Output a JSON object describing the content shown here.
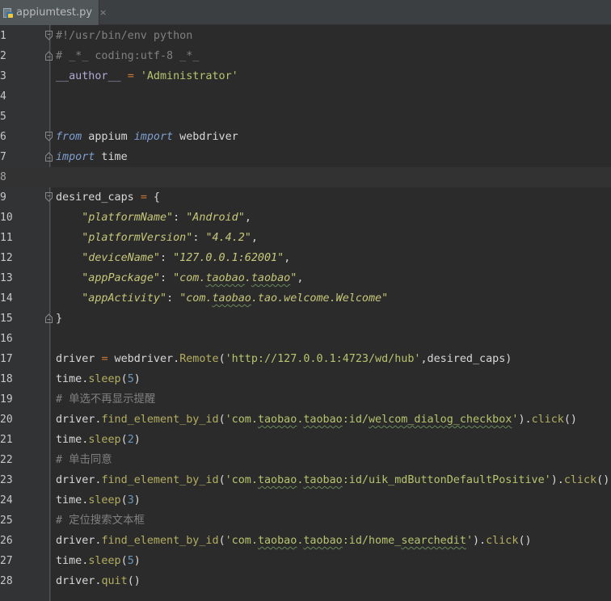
{
  "tab": {
    "filename": "appiumtest.py",
    "close_glyph": "×",
    "icon": "python-file-icon"
  },
  "colors": {
    "background": "#2b2b2b",
    "gutter": "#313335",
    "current_line": "#323232",
    "comment": "#808080",
    "keyword": "#7f9fd0",
    "string": "#b9c46e",
    "method": "#b3ae60",
    "number": "#6897bb"
  },
  "current_line": 8,
  "lines": [
    {
      "n": "1",
      "fold": "open",
      "tokens": [
        {
          "c": "t-comment",
          "t": "#!/usr/bin/env python"
        }
      ]
    },
    {
      "n": "2",
      "fold": "close",
      "tokens": [
        {
          "c": "t-comment",
          "t": "# _*_ coding:utf-8 _*_"
        }
      ]
    },
    {
      "n": "3",
      "fold": "",
      "tokens": [
        {
          "c": "t-dunder",
          "t": "__author__"
        },
        {
          "c": "t-default",
          "t": " "
        },
        {
          "c": "t-punct",
          "t": "="
        },
        {
          "c": "t-default",
          "t": " "
        },
        {
          "c": "t-string",
          "t": "'Administrator'"
        }
      ]
    },
    {
      "n": "4",
      "fold": "",
      "tokens": []
    },
    {
      "n": "5",
      "fold": "",
      "tokens": []
    },
    {
      "n": "6",
      "fold": "open",
      "tokens": [
        {
          "c": "t-kw",
          "t": "from"
        },
        {
          "c": "t-var",
          "t": " appium "
        },
        {
          "c": "t-kw",
          "t": "import"
        },
        {
          "c": "t-var",
          "t": " webdriver"
        }
      ]
    },
    {
      "n": "7",
      "fold": "close",
      "tokens": [
        {
          "c": "t-kw",
          "t": "import"
        },
        {
          "c": "t-var",
          "t": " time"
        }
      ]
    },
    {
      "n": "8",
      "fold": "",
      "tokens": []
    },
    {
      "n": "9",
      "fold": "open",
      "tokens": [
        {
          "c": "t-var",
          "t": "desired_caps "
        },
        {
          "c": "t-punct",
          "t": "="
        },
        {
          "c": "t-var",
          "t": " {"
        }
      ]
    },
    {
      "n": "10",
      "fold": "",
      "tokens": [
        {
          "c": "t-default",
          "t": "    "
        },
        {
          "c": "t-str-it",
          "t": "\"platformName\""
        },
        {
          "c": "t-var",
          "t": ": "
        },
        {
          "c": "t-str-it",
          "t": "\"Android\""
        },
        {
          "c": "t-var",
          "t": ","
        }
      ]
    },
    {
      "n": "11",
      "fold": "",
      "tokens": [
        {
          "c": "t-default",
          "t": "    "
        },
        {
          "c": "t-str-it",
          "t": "\"platformVersion\""
        },
        {
          "c": "t-var",
          "t": ": "
        },
        {
          "c": "t-str-it",
          "t": "\"4.4.2\""
        },
        {
          "c": "t-var",
          "t": ","
        }
      ]
    },
    {
      "n": "12",
      "fold": "",
      "tokens": [
        {
          "c": "t-default",
          "t": "    "
        },
        {
          "c": "t-str-it",
          "t": "\"deviceName\""
        },
        {
          "c": "t-var",
          "t": ": "
        },
        {
          "c": "t-str-it",
          "t": "\"127.0.0.1:62001\""
        },
        {
          "c": "t-var",
          "t": ","
        }
      ]
    },
    {
      "n": "13",
      "fold": "",
      "tokens": [
        {
          "c": "t-default",
          "t": "    "
        },
        {
          "c": "t-str-it",
          "t": "\"appPackage\""
        },
        {
          "c": "t-var",
          "t": ": "
        },
        {
          "c": "t-str-it",
          "t": "\"com."
        },
        {
          "c": "t-str-it t-squig",
          "t": "taobao"
        },
        {
          "c": "t-str-it",
          "t": "."
        },
        {
          "c": "t-str-it t-squig",
          "t": "taobao"
        },
        {
          "c": "t-str-it",
          "t": "\""
        },
        {
          "c": "t-var",
          "t": ","
        }
      ]
    },
    {
      "n": "14",
      "fold": "",
      "tokens": [
        {
          "c": "t-default",
          "t": "    "
        },
        {
          "c": "t-str-it",
          "t": "\"appActivity\""
        },
        {
          "c": "t-var",
          "t": ": "
        },
        {
          "c": "t-str-it",
          "t": "\"com."
        },
        {
          "c": "t-str-it t-squig",
          "t": "taobao"
        },
        {
          "c": "t-str-it",
          "t": ".tao.welcome.Welcome\""
        }
      ]
    },
    {
      "n": "15",
      "fold": "close",
      "tokens": [
        {
          "c": "t-var",
          "t": "}"
        }
      ]
    },
    {
      "n": "16",
      "fold": "",
      "tokens": []
    },
    {
      "n": "17",
      "fold": "",
      "tokens": [
        {
          "c": "t-var",
          "t": "driver "
        },
        {
          "c": "t-punct",
          "t": "="
        },
        {
          "c": "t-var",
          "t": " webdriver."
        },
        {
          "c": "t-method",
          "t": "Remote"
        },
        {
          "c": "t-var",
          "t": "("
        },
        {
          "c": "t-string",
          "t": "'http://127.0.0.1:4723/wd/hub'"
        },
        {
          "c": "t-var",
          "t": ",desired_caps)"
        }
      ]
    },
    {
      "n": "18",
      "fold": "",
      "tokens": [
        {
          "c": "t-var",
          "t": "time."
        },
        {
          "c": "t-method",
          "t": "sleep"
        },
        {
          "c": "t-var",
          "t": "("
        },
        {
          "c": "t-number",
          "t": "5"
        },
        {
          "c": "t-var",
          "t": ")"
        }
      ]
    },
    {
      "n": "19",
      "fold": "",
      "tokens": [
        {
          "c": "t-comment",
          "t": "# 单选不再显示提醒"
        }
      ]
    },
    {
      "n": "20",
      "fold": "",
      "tokens": [
        {
          "c": "t-var",
          "t": "driver."
        },
        {
          "c": "t-method",
          "t": "find_element_by_id"
        },
        {
          "c": "t-var",
          "t": "("
        },
        {
          "c": "t-string",
          "t": "'com."
        },
        {
          "c": "t-string t-squig",
          "t": "taobao"
        },
        {
          "c": "t-string",
          "t": "."
        },
        {
          "c": "t-string t-squig",
          "t": "taobao"
        },
        {
          "c": "t-string",
          "t": ":id/"
        },
        {
          "c": "t-string t-squig",
          "t": "welcom_dialog_checkbox"
        },
        {
          "c": "t-string",
          "t": "'"
        },
        {
          "c": "t-var",
          "t": ")."
        },
        {
          "c": "t-method",
          "t": "click"
        },
        {
          "c": "t-var",
          "t": "()"
        }
      ]
    },
    {
      "n": "21",
      "fold": "",
      "tokens": [
        {
          "c": "t-var",
          "t": "time."
        },
        {
          "c": "t-method",
          "t": "sleep"
        },
        {
          "c": "t-var",
          "t": "("
        },
        {
          "c": "t-number",
          "t": "2"
        },
        {
          "c": "t-var",
          "t": ")"
        }
      ]
    },
    {
      "n": "22",
      "fold": "",
      "tokens": [
        {
          "c": "t-comment",
          "t": "# 单击同意"
        }
      ]
    },
    {
      "n": "23",
      "fold": "",
      "tokens": [
        {
          "c": "t-var",
          "t": "driver."
        },
        {
          "c": "t-method",
          "t": "find_element_by_id"
        },
        {
          "c": "t-var",
          "t": "("
        },
        {
          "c": "t-string",
          "t": "'com."
        },
        {
          "c": "t-string t-squig",
          "t": "taobao"
        },
        {
          "c": "t-string",
          "t": "."
        },
        {
          "c": "t-string t-squig",
          "t": "taobao"
        },
        {
          "c": "t-string",
          "t": ":id/uik_mdButtonDefaultPositive'"
        },
        {
          "c": "t-var",
          "t": ")."
        },
        {
          "c": "t-method",
          "t": "click"
        },
        {
          "c": "t-var",
          "t": "()"
        }
      ]
    },
    {
      "n": "24",
      "fold": "",
      "tokens": [
        {
          "c": "t-var",
          "t": "time."
        },
        {
          "c": "t-method",
          "t": "sleep"
        },
        {
          "c": "t-var",
          "t": "("
        },
        {
          "c": "t-number",
          "t": "3"
        },
        {
          "c": "t-var",
          "t": ")"
        }
      ]
    },
    {
      "n": "25",
      "fold": "",
      "tokens": [
        {
          "c": "t-comment",
          "t": "# 定位搜索文本框"
        }
      ]
    },
    {
      "n": "26",
      "fold": "",
      "tokens": [
        {
          "c": "t-var",
          "t": "driver."
        },
        {
          "c": "t-method",
          "t": "find_element_by_id"
        },
        {
          "c": "t-var",
          "t": "("
        },
        {
          "c": "t-string",
          "t": "'com."
        },
        {
          "c": "t-string t-squig",
          "t": "taobao"
        },
        {
          "c": "t-string",
          "t": "."
        },
        {
          "c": "t-string t-squig",
          "t": "taobao"
        },
        {
          "c": "t-string",
          "t": ":id/home_"
        },
        {
          "c": "t-string t-squig",
          "t": "searchedit"
        },
        {
          "c": "t-string",
          "t": "'"
        },
        {
          "c": "t-var",
          "t": ")."
        },
        {
          "c": "t-method",
          "t": "click"
        },
        {
          "c": "t-var",
          "t": "()"
        }
      ]
    },
    {
      "n": "27",
      "fold": "",
      "tokens": [
        {
          "c": "t-var",
          "t": "time."
        },
        {
          "c": "t-method",
          "t": "sleep"
        },
        {
          "c": "t-var",
          "t": "("
        },
        {
          "c": "t-number",
          "t": "5"
        },
        {
          "c": "t-var",
          "t": ")"
        }
      ]
    },
    {
      "n": "28",
      "fold": "",
      "tokens": [
        {
          "c": "t-var",
          "t": "driver."
        },
        {
          "c": "t-method",
          "t": "quit"
        },
        {
          "c": "t-var",
          "t": "()"
        }
      ]
    }
  ]
}
